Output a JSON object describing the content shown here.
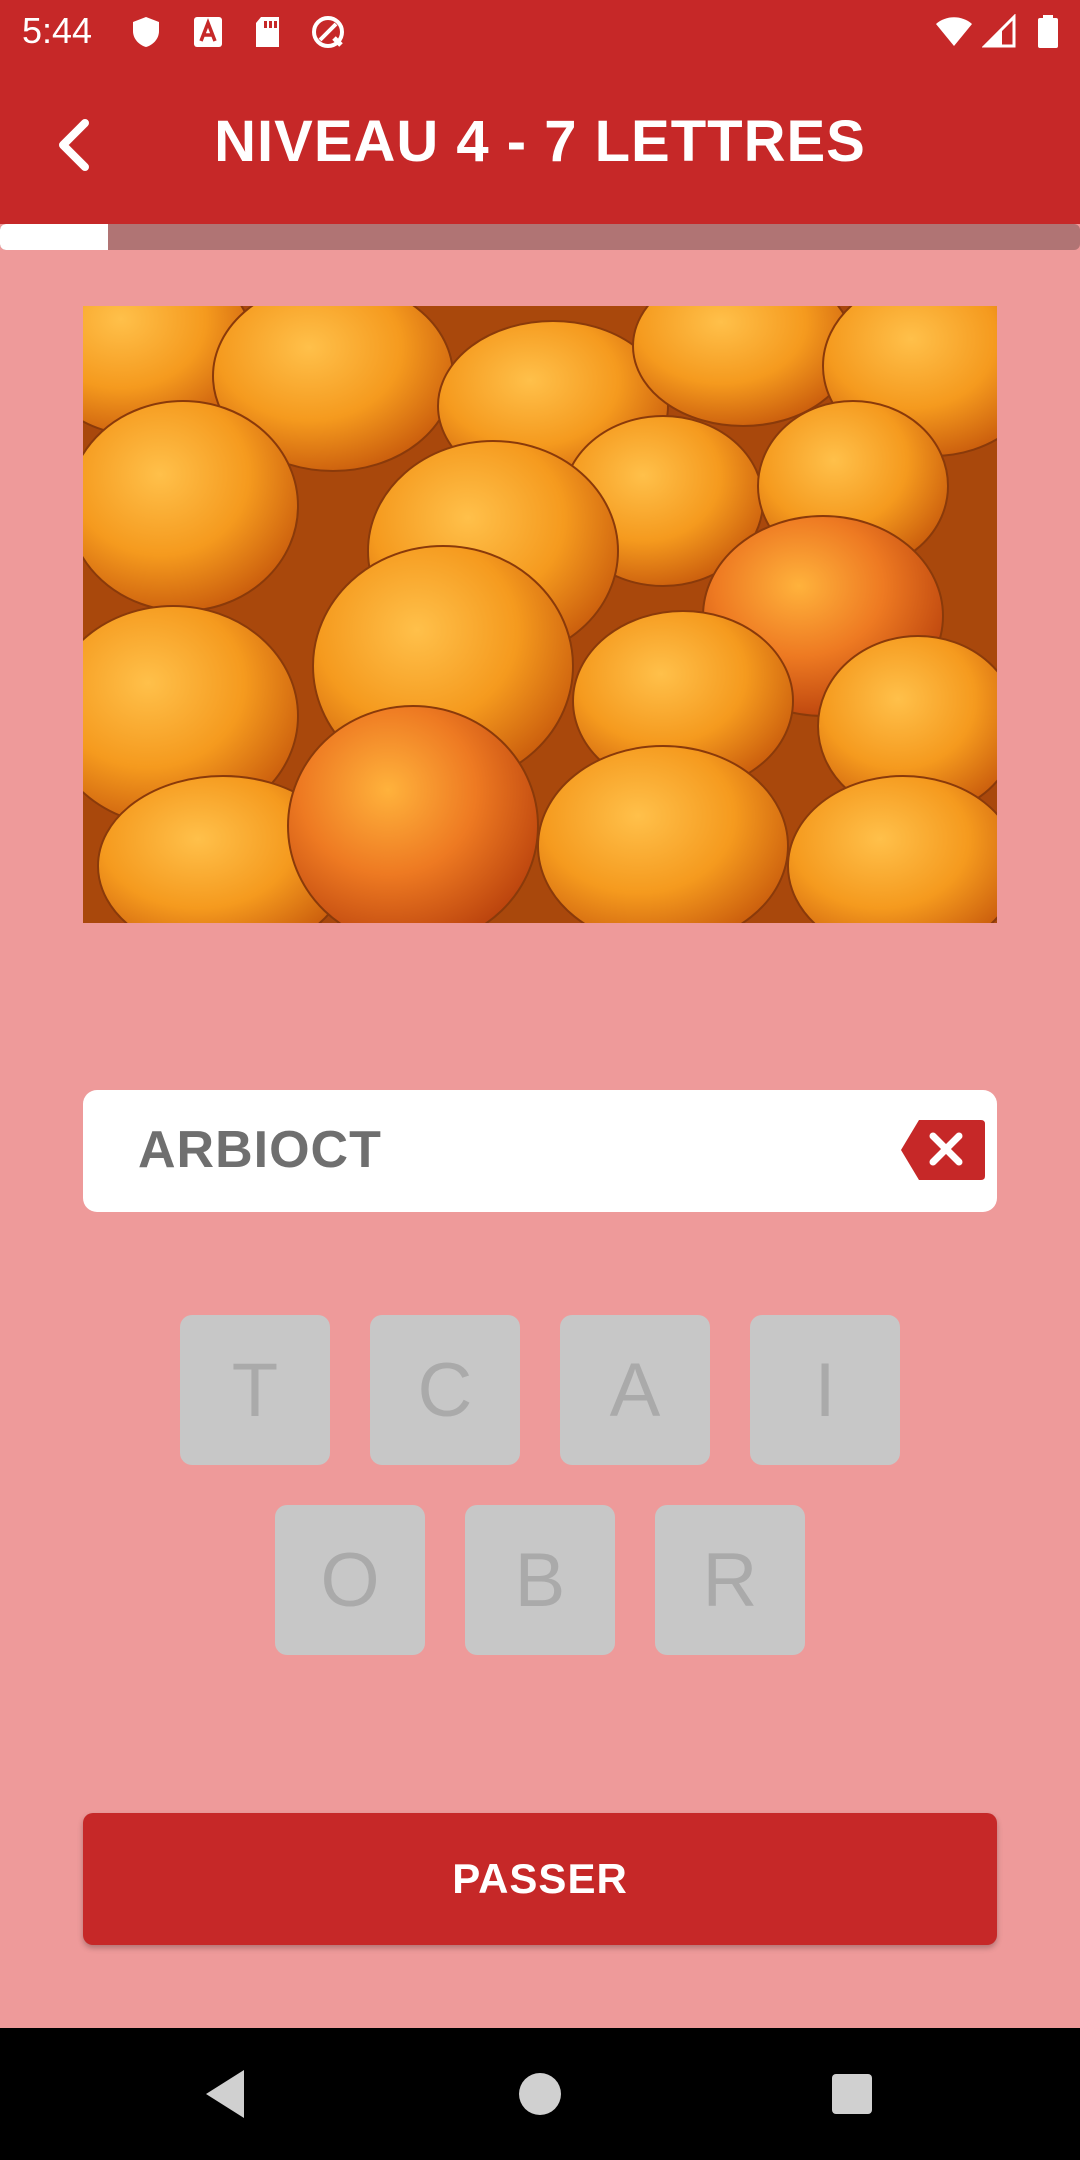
{
  "status_bar": {
    "time": "5:44",
    "left_icons": [
      "shield-icon",
      "a-letter-icon",
      "sd-card-icon",
      "sync-icon"
    ],
    "right_icons": [
      "wifi-icon",
      "signal-icon",
      "battery-icon"
    ]
  },
  "app_bar": {
    "title": "NIVEAU 4 - 7 LETTRES",
    "back_icon": "chevron-left-icon"
  },
  "progress": {
    "value": 0.1
  },
  "puzzle": {
    "image_subject": "apricots",
    "answer": "ARBIOCT",
    "clear_icon": "backspace-x-icon",
    "letters_row1": [
      "T",
      "C",
      "A",
      "I"
    ],
    "letters_row2": [
      "O",
      "B",
      "R"
    ]
  },
  "actions": {
    "pass_label": "PASSER"
  },
  "colors": {
    "primary": "#c62828",
    "background": "#ee9a9a",
    "tile": "#c7c7c7",
    "tile_text": "#aaaaaa"
  },
  "nav_bar": {
    "icons": [
      "back-triangle-icon",
      "home-circle-icon",
      "recents-square-icon"
    ]
  }
}
